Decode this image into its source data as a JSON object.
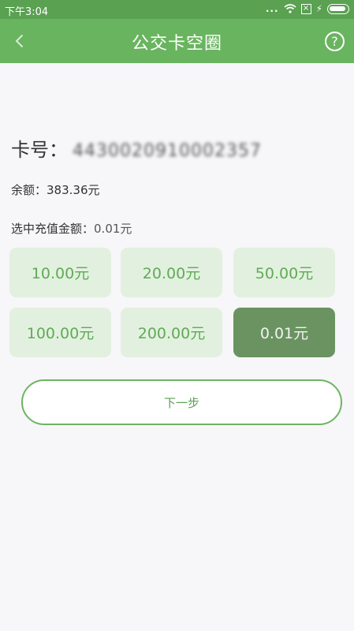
{
  "status_bar": {
    "time": "下午3:04",
    "signal_dots": "...",
    "wifi_icon": "wifi-icon",
    "sim_icon": "x-box-icon",
    "charging_icon": "bolt-icon",
    "battery_icon": "battery-icon"
  },
  "header": {
    "title": "公交卡空圈",
    "back_glyph": "<",
    "help_glyph": "?",
    "color": "#69b45f"
  },
  "card": {
    "label": "卡号：",
    "number": "4430020910002357"
  },
  "balance": {
    "label": "余额：",
    "value": "383.36元"
  },
  "selected_amount": {
    "label": "选中充值金额：",
    "value": "0.01元"
  },
  "amounts": [
    {
      "label": "10.00元",
      "selected": false
    },
    {
      "label": "20.00元",
      "selected": false
    },
    {
      "label": "50.00元",
      "selected": false
    },
    {
      "label": "100.00元",
      "selected": false
    },
    {
      "label": "200.00元",
      "selected": false
    },
    {
      "label": "0.01元",
      "selected": true
    }
  ],
  "next_button": {
    "label": "下一步"
  }
}
